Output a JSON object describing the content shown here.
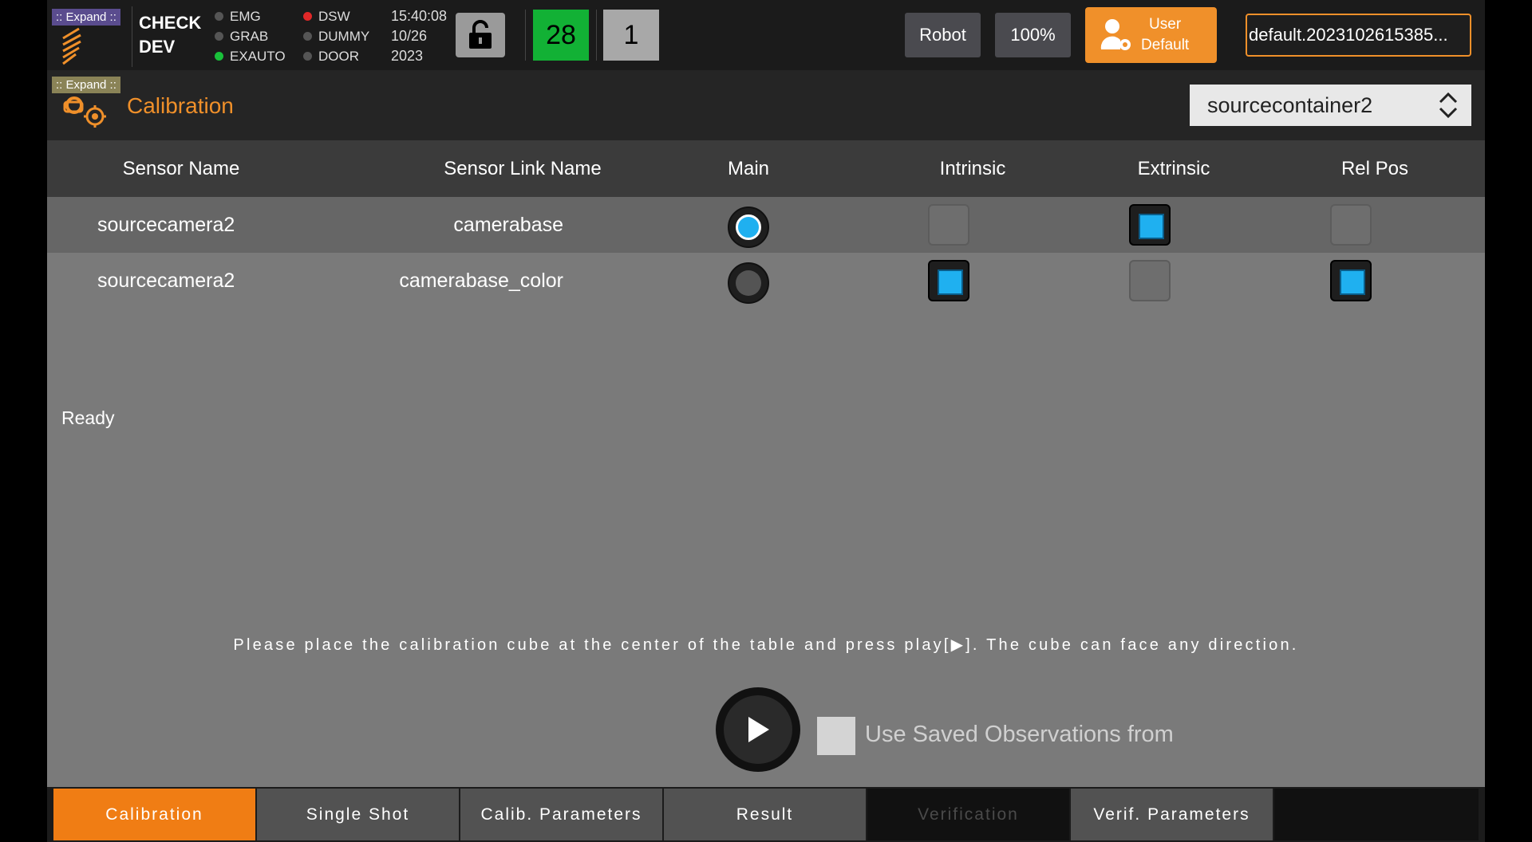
{
  "topbar": {
    "expand_label": ":: Expand ::",
    "check_dev": [
      "CHECK",
      "DEV"
    ],
    "status_col1": [
      {
        "label": "EMG",
        "color": "#555555"
      },
      {
        "label": "GRAB",
        "color": "#555555"
      },
      {
        "label": "EXAUTO",
        "color": "#19c03a"
      }
    ],
    "status_col2": [
      {
        "label": "DSW",
        "color": "#e02828"
      },
      {
        "label": "DUMMY",
        "color": "#555555"
      },
      {
        "label": "DOOR",
        "color": "#555555"
      }
    ],
    "time": "15:40:08",
    "date": "10/26",
    "year": "2023",
    "counter_green": "28",
    "counter_gray": "1",
    "robot_label": "Robot",
    "speed_label": "100%",
    "user_line1": "User",
    "user_line2": "Default",
    "project_name": "default.2023102615385..."
  },
  "header": {
    "expand_label": ":: Expand ::",
    "title": "Calibration",
    "container_selected": "sourcecontainer2"
  },
  "table": {
    "columns": [
      "Sensor Name",
      "Sensor Link Name",
      "Main",
      "Intrinsic",
      "Extrinsic",
      "Rel Pos"
    ],
    "rows": [
      {
        "sensor_name": "sourcecamera2",
        "link_name": "camerabase",
        "main": true,
        "intrinsic": false,
        "extrinsic": true,
        "rel_pos": false
      },
      {
        "sensor_name": "sourcecamera2",
        "link_name": "camerabase_color",
        "main": false,
        "intrinsic": true,
        "extrinsic": false,
        "rel_pos": true
      }
    ]
  },
  "status": "Ready",
  "instruction": "Please place the calibration cube at the center of the table and press play[▶]. The cube can face any direction.",
  "saved_observations_label": "Use Saved Observations from",
  "tabs": [
    {
      "label": "Calibration",
      "state": "active"
    },
    {
      "label": "Single Shot",
      "state": "normal"
    },
    {
      "label": "Calib. Parameters",
      "state": "normal"
    },
    {
      "label": "Result",
      "state": "normal"
    },
    {
      "label": "Verification",
      "state": "disabled"
    },
    {
      "label": "Verif. Parameters",
      "state": "normal"
    }
  ],
  "colors": {
    "accent": "#f0902a",
    "selection": "#1fb0f0",
    "active_tab": "#f07d14"
  }
}
